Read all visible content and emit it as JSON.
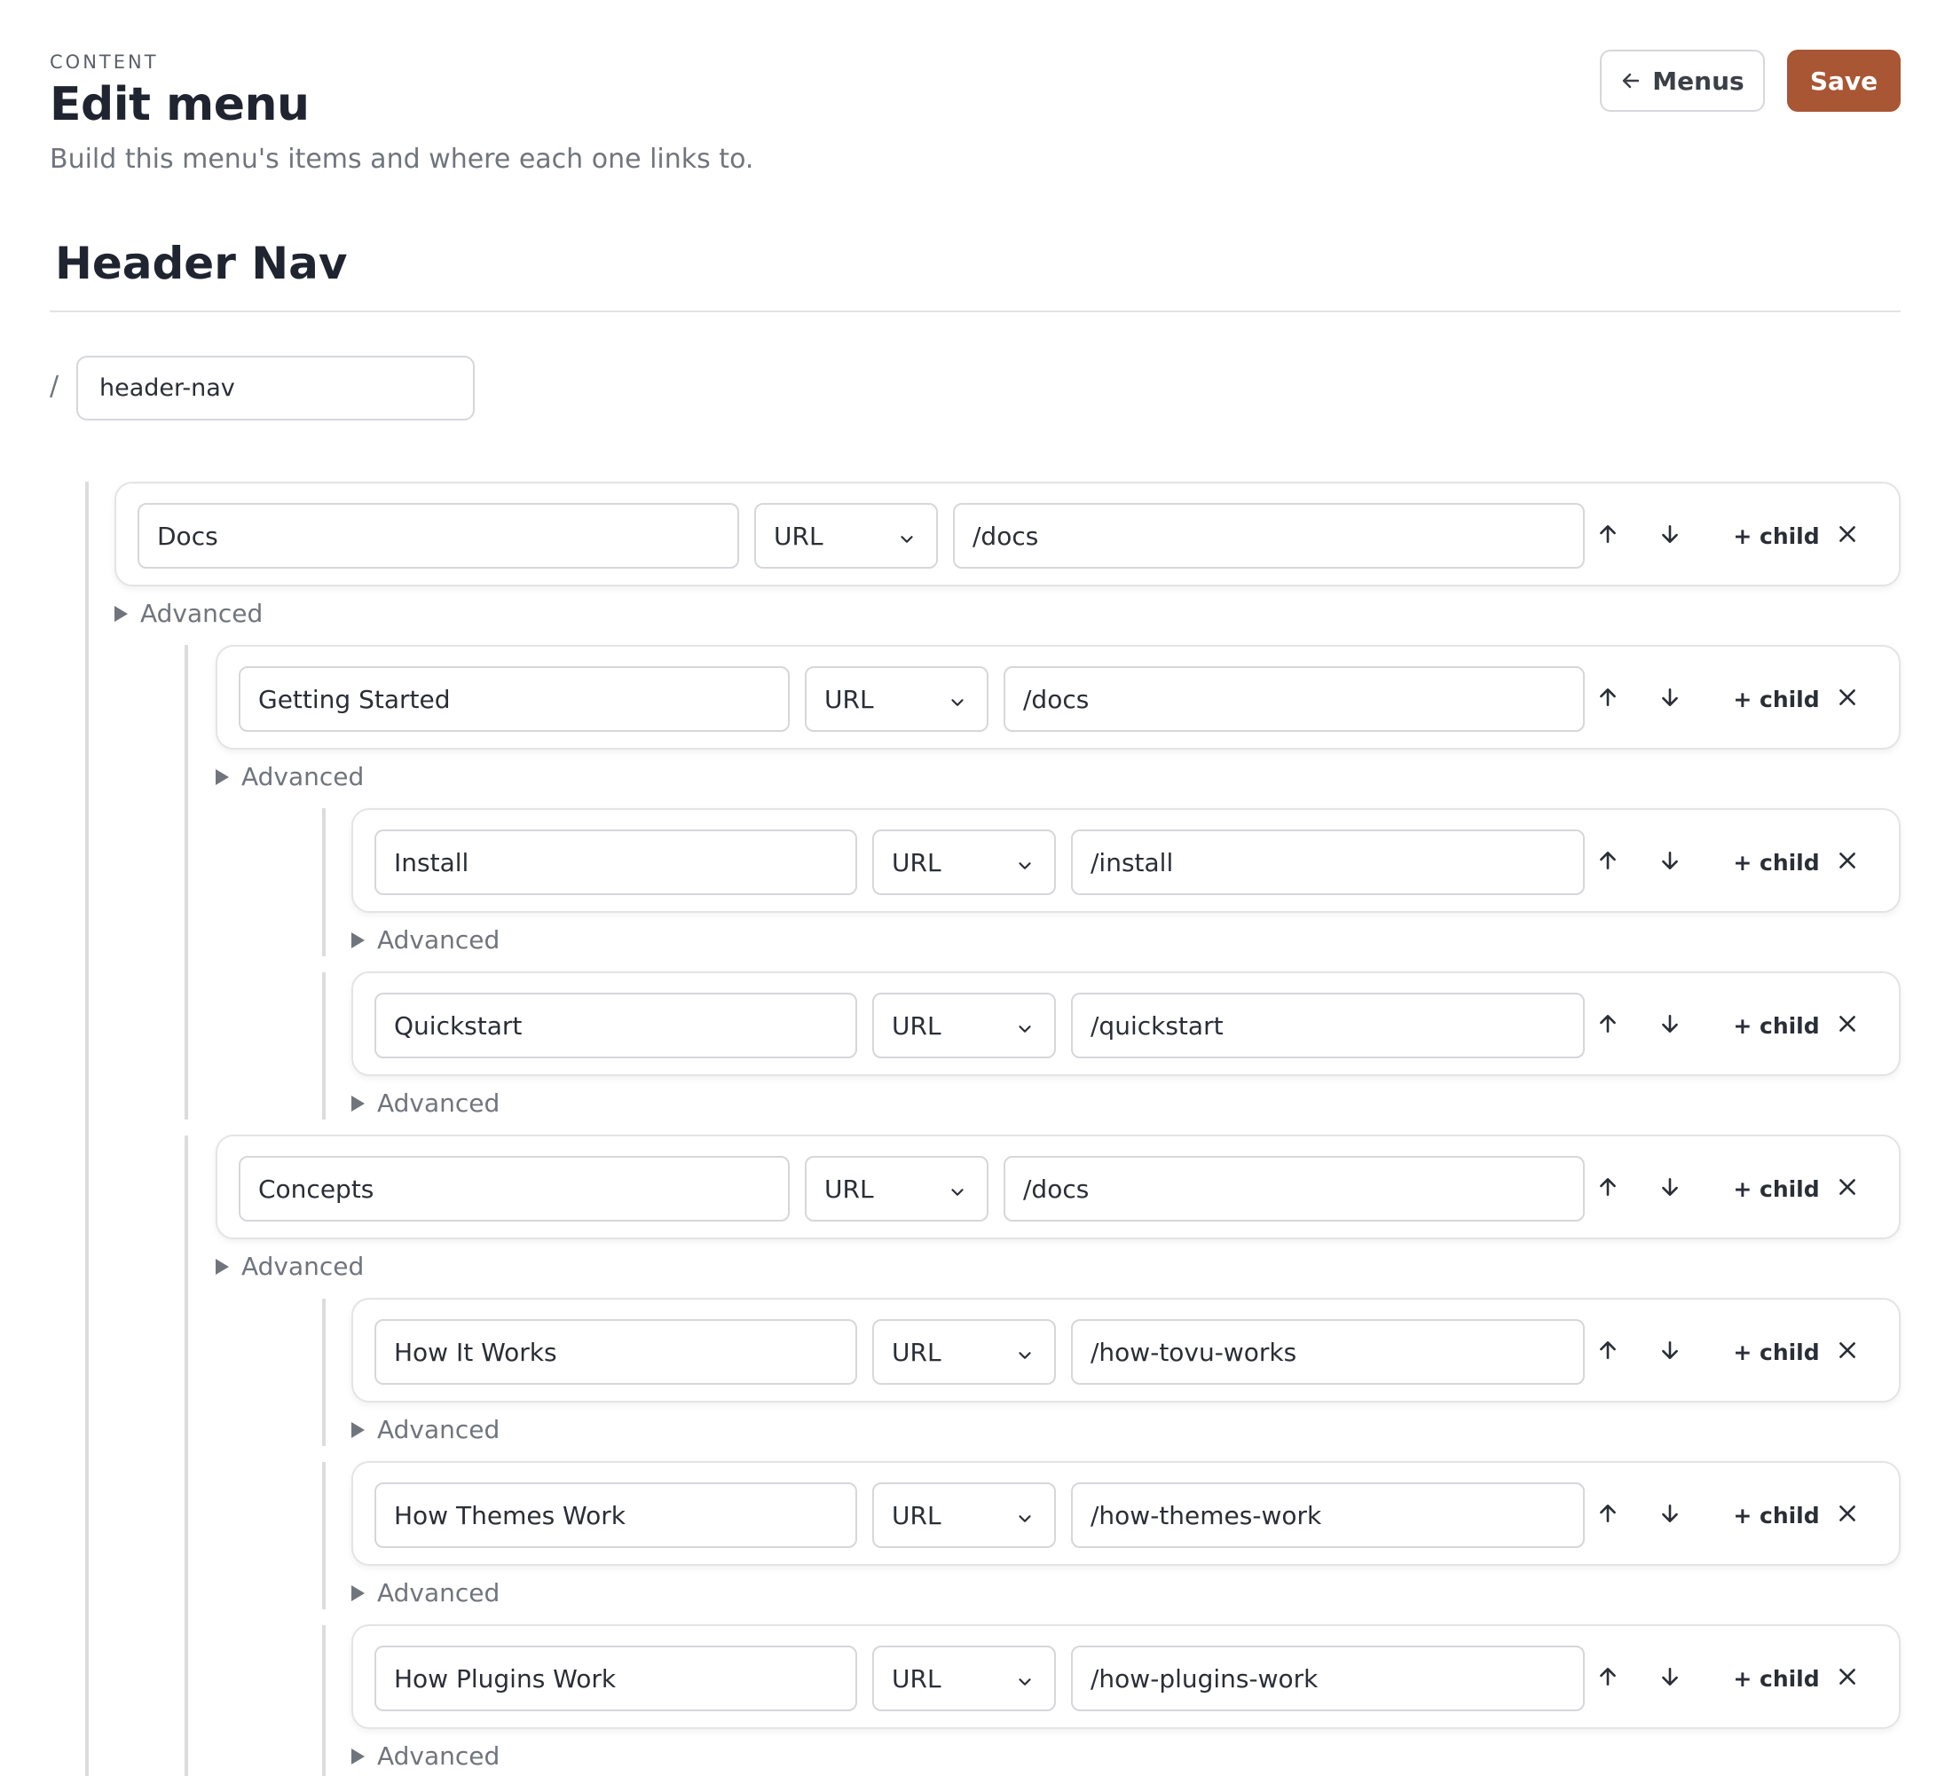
{
  "header": {
    "eyebrow": "CONTENT",
    "title": "Edit menu",
    "subtitle": "Build this menu's items and where each one links to.",
    "menus_button": "Menus",
    "save_button": "Save"
  },
  "menu": {
    "name": "Header Nav",
    "slug_prefix": "/",
    "slug": "header-nav"
  },
  "labels": {
    "advanced": "Advanced",
    "add_child": "+ child"
  },
  "icons": {
    "menus_button": "arrow-left-icon",
    "move_up": "arrow-up-icon",
    "move_down": "arrow-down-icon",
    "remove": "close-icon",
    "type_select": "chevron-down-icon",
    "advanced_toggle": "caret-right-icon"
  },
  "colors": {
    "accent": "#a85634"
  },
  "items": [
    {
      "label": "Docs",
      "type": "URL",
      "url": "/docs",
      "depth": 0
    },
    {
      "label": "Getting Started",
      "type": "URL",
      "url": "/docs",
      "depth": 1
    },
    {
      "label": "Install",
      "type": "URL",
      "url": "/install",
      "depth": 2
    },
    {
      "label": "Quickstart",
      "type": "URL",
      "url": "/quickstart",
      "depth": 2
    },
    {
      "label": "Concepts",
      "type": "URL",
      "url": "/docs",
      "depth": 1
    },
    {
      "label": "How It Works",
      "type": "URL",
      "url": "/how-tovu-works",
      "depth": 2
    },
    {
      "label": "How Themes Work",
      "type": "URL",
      "url": "/how-themes-work",
      "depth": 2
    },
    {
      "label": "How Plugins Work",
      "type": "URL",
      "url": "/how-plugins-work",
      "depth": 2
    }
  ]
}
